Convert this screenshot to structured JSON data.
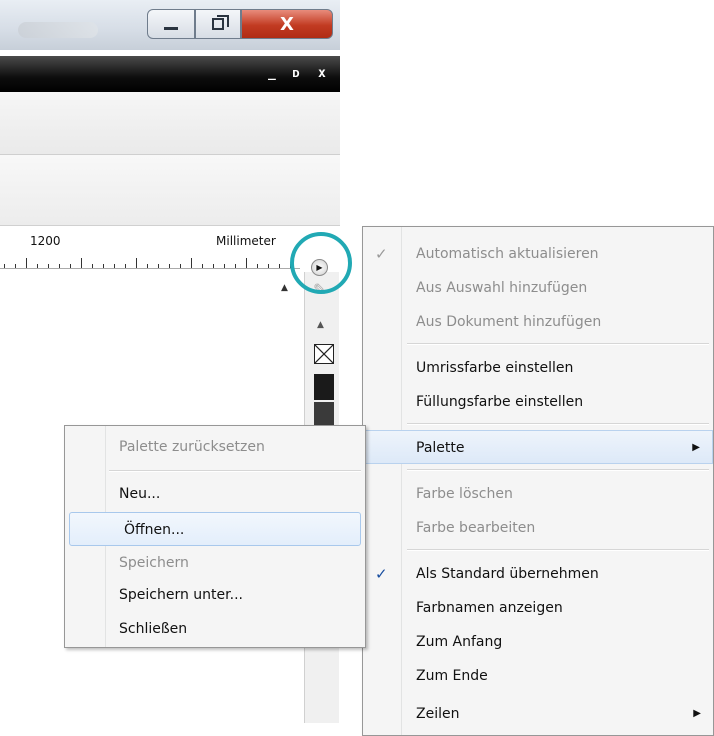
{
  "window": {
    "minimize_icon": "minimize-icon",
    "maximize_icon": "restore-icon",
    "close_label": "X"
  },
  "document_controls": {
    "minimize": "_",
    "restore": "ᴅ",
    "close": "x"
  },
  "ruler": {
    "tick_label": "1200",
    "unit": "Millimeter"
  },
  "context_menu": {
    "items": [
      {
        "label": "Automatisch aktualisieren",
        "disabled": true,
        "checked": true
      },
      {
        "label": "Aus Auswahl hinzufügen",
        "disabled": true
      },
      {
        "label": "Aus Dokument hinzufügen",
        "disabled": true
      },
      {
        "label": "Umrissfarbe einstellen"
      },
      {
        "label": "Füllungsfarbe einstellen"
      },
      {
        "label": "Palette",
        "submenu": true,
        "highlighted": true
      },
      {
        "label": "Farbe löschen",
        "disabled": true
      },
      {
        "label": "Farbe bearbeiten",
        "disabled": true
      },
      {
        "label": "Als Standard übernehmen",
        "checked": true
      },
      {
        "label": "Farbnamen anzeigen"
      },
      {
        "label": "Zum Anfang"
      },
      {
        "label": "Zum Ende"
      },
      {
        "label": "Zeilen",
        "submenu": true
      }
    ],
    "check_glyph": "✓",
    "submenu_glyph": "▶"
  },
  "palette_submenu": {
    "items": [
      {
        "label": "Palette zurücksetzen",
        "disabled": true
      },
      {
        "label": "Neu..."
      },
      {
        "label": "Öffnen...",
        "highlighted": true
      },
      {
        "label": "Speichern",
        "disabled": true
      },
      {
        "label": "Speichern unter..."
      },
      {
        "label": "Schließen"
      }
    ]
  },
  "colors": {
    "highlight_ring": "#21a9b4",
    "close_button": "#c23b22",
    "menu_hover_border": "#a8c8ec",
    "disabled_text": "#8d8d8d"
  }
}
